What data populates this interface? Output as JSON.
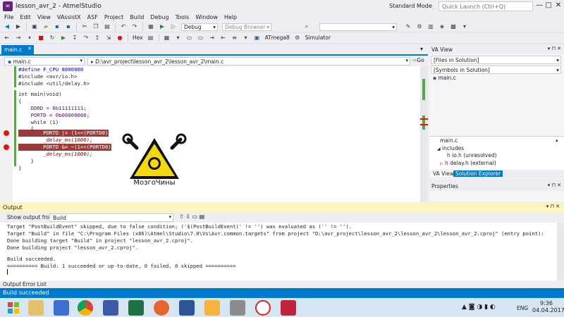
{
  "window": {
    "title": "lesson_avr_2 - AtmelStudio",
    "layout_mode": "Standard Mode",
    "quick_launch_placeholder": "Quick Launch (Ctrl+Q)"
  },
  "menu": [
    "File",
    "Edit",
    "View",
    "VAssistX",
    "ASF",
    "Project",
    "Build",
    "Debug",
    "Tools",
    "Window",
    "Help"
  ],
  "toolbar": {
    "config": "Debug",
    "debug_browser": "Debug Browser",
    "hex": "Hex",
    "device": "ATmega8",
    "tool": "Simulator"
  },
  "editor": {
    "tab": "main.c",
    "scope_combo": "main.c",
    "path_combo": "D:\\avr_project\\lesson_avr_2\\lesson_avr_2\\main.c",
    "go_label": "Go",
    "lines": [
      "#define F_CPU 8000000",
      "#include <avr/io.h>",
      "#include <util/delay.h>",
      "",
      "int main(void)",
      "{",
      "    DDRD = 0b11111111;",
      "    PORTD = 0b00000000;",
      "    while (1)",
      "    {",
      "        PORTD |= (1<<(PORTD0));",
      "        _delay_ms(1000);",
      "        PORTD &= ~(1<<(PORTD0));",
      "        _delay_ms(1000);",
      "    }",
      "}"
    ]
  },
  "va_view": {
    "title": "VA View",
    "files_combo": "[Files in Solution]",
    "symbols_combo": "[Symbols in Solution]",
    "file_item": "main.c",
    "tree_root": "main.c",
    "includes_label": "includes",
    "includes": [
      "io.h (unresolved)",
      "delay.h (external)"
    ],
    "tabs": [
      "VA View",
      "Solution Explorer"
    ]
  },
  "properties": {
    "title": "Properties"
  },
  "logo": {
    "text": "МозгоЧины"
  },
  "output": {
    "title": "Output",
    "show_from_label": "Show output from:",
    "show_from_value": "Build",
    "lines": [
      "Target \"PostBuildEvent\" skipped, due to false condition; ('$(PostBuildEvent)' != '') was evaluated as ('' != '').",
      "Target \"Build\" in file \"C:\\Program Files (x86)\\Atmel\\Studio\\7.0\\Vs\\Avr.common.targets\" from project \"D:\\avr_project\\lesson_avr_2\\lesson_avr_2\\lesson_avr_2.cproj\" (entry point):",
      "Done building target \"Build\" in project \"lesson_avr_2.cproj\".",
      "Done building project \"lesson_avr_2.cproj\".",
      "",
      "Build succeeded.",
      "========== Build: 1 succeeded or up-to-date, 0 failed, 0 skipped =========="
    ],
    "tabs": [
      "Output",
      "Error List"
    ]
  },
  "status": {
    "text": "Build succeeded"
  },
  "taskbar": {
    "time": "9:36",
    "date": "04.04.2017",
    "lang": "ENG"
  },
  "colors": {
    "accent": "#007acc",
    "breakpoint": "#e51400",
    "breakpoint_line": "#9c3b3b",
    "output_header": "#fdf4bf"
  }
}
